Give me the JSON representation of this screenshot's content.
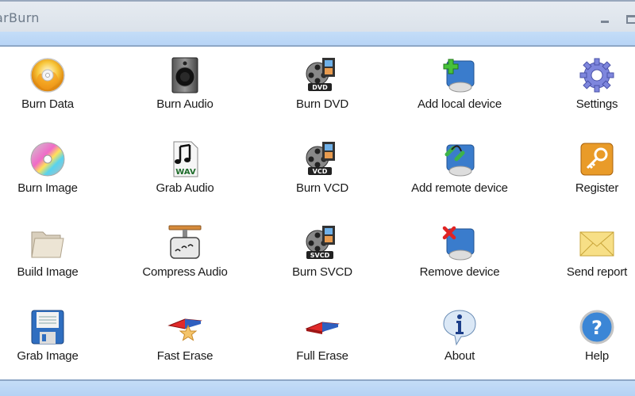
{
  "window": {
    "title": "StarBurn",
    "title_visible": "arBurn",
    "controls": [
      "minimize",
      "maximize"
    ]
  },
  "items": [
    {
      "label": "Burn Data",
      "icon": "burn-disc-icon"
    },
    {
      "label": "Burn Audio",
      "icon": "speaker-icon"
    },
    {
      "label": "Burn DVD",
      "icon": "film-reel-dvd-icon"
    },
    {
      "label": "Add local device",
      "icon": "drive-add-icon"
    },
    {
      "label": "Settings",
      "icon": "gear-icon"
    },
    {
      "label": "Burn Image",
      "icon": "cd-icon"
    },
    {
      "label": "Grab Audio",
      "icon": "wav-file-icon"
    },
    {
      "label": "Burn VCD",
      "icon": "film-reel-vcd-icon"
    },
    {
      "label": "Add remote device",
      "icon": "drive-remote-icon"
    },
    {
      "label": "Register",
      "icon": "key-icon"
    },
    {
      "label": "Build Image",
      "icon": "folder-icon"
    },
    {
      "label": "Compress Audio",
      "icon": "compress-audio-icon"
    },
    {
      "label": "Burn SVCD",
      "icon": "film-reel-svcd-icon"
    },
    {
      "label": "Remove device",
      "icon": "drive-remove-icon"
    },
    {
      "label": "Send report",
      "icon": "envelope-icon"
    },
    {
      "label": "Grab Image",
      "icon": "floppy-disk-icon"
    },
    {
      "label": "Fast Erase",
      "icon": "eraser-star-icon"
    },
    {
      "label": "Full Erase",
      "icon": "eraser-icon"
    },
    {
      "label": "About",
      "icon": "info-bubble-icon"
    },
    {
      "label": "Help",
      "icon": "help-icon"
    }
  ],
  "badges": {
    "dvd": "DVD",
    "vcd": "VCD",
    "svcd": "SVCD",
    "wav": "WAV"
  },
  "colors": {
    "titlebar": "#dbe2ea",
    "menubar": "#b7d4f6",
    "statusbar": "#b5d2f4",
    "border": "#8ea7c6"
  }
}
